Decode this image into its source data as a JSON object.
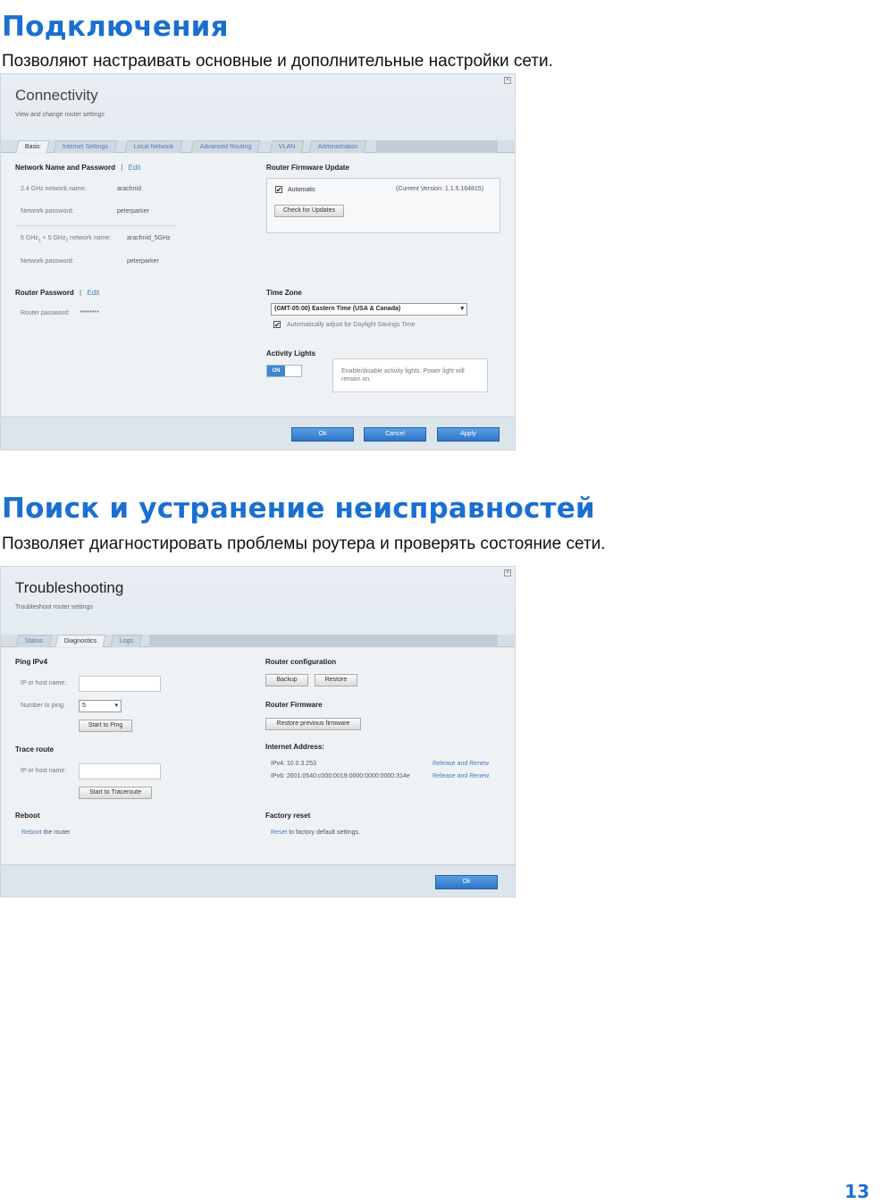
{
  "connectivity": {
    "heading": "Подключения",
    "description": "Позволяют настраивать основные и дополнительные настройки сети.",
    "window_title": "Connectivity",
    "window_subtitle": "View and change router settings",
    "close_label": "×",
    "tabs": [
      {
        "label": "Basic"
      },
      {
        "label": "Internet Settings"
      },
      {
        "label": "Local Network"
      },
      {
        "label": "Advanced Routing"
      },
      {
        "label": "VLAN"
      },
      {
        "label": "Administration"
      }
    ],
    "network": {
      "title": "Network Name and Password",
      "separator": "|",
      "edit": "Edit",
      "name_24_label": "2.4 GHz network name:",
      "name_24_value": "arachnid",
      "password_label": "Network password:",
      "password_24_value": "peterparker",
      "name_5_label_a": "5 GHz",
      "name_5_sub1": "1",
      "name_5_plus": " + 5 GHz",
      "name_5_sub2": "2",
      "name_5_label_b": " network name:",
      "name_5_value": "arachnid_5GHz",
      "password_5_value": "peterparker"
    },
    "router_password": {
      "title": "Router Password",
      "separator": "|",
      "edit": "Edit",
      "label": "Router password:",
      "value": "********"
    },
    "firmware": {
      "title": "Router Firmware Update",
      "check_mark": "✔",
      "automatic_label": "Automatic",
      "version": "(Current Version: 1.1.5.164815)",
      "check_button": "Check for Updates"
    },
    "time_zone": {
      "title": "Time Zone",
      "selected": "(GMT-05:00) Eastern Time (USA & Canada)",
      "arrow": "▾",
      "check_mark": "✔",
      "dst_label": "Automatically adjust for Daylight Savings Time"
    },
    "activity_lights": {
      "title": "Activity Lights",
      "toggle_label": "ON",
      "info": "Enable/disable activity lights. Power light will remain on."
    },
    "buttons": {
      "ok": "Ok",
      "cancel": "Cancel",
      "apply": "Apply"
    }
  },
  "troubleshooting": {
    "heading": "Поиск и устранение неисправностей",
    "description": "Позволяет диагностировать проблемы роутера и проверять состояние сети.",
    "window_title": "Troubleshooting",
    "window_subtitle": "Troubleshoot router settings",
    "close_label": "×",
    "tabs": [
      {
        "label": "Status"
      },
      {
        "label": "Diagnostics"
      },
      {
        "label": "Logs"
      }
    ],
    "ping": {
      "title": "Ping IPv4",
      "host_label": "IP or host name:",
      "host_value": "",
      "number_label": "Number to ping:",
      "number_value": "5",
      "arrow": "▾",
      "start_button": "Start to Ping"
    },
    "trace": {
      "title": "Trace route",
      "host_label": "IP or host name:",
      "host_value": "",
      "start_button": "Start to Traceroute"
    },
    "reboot": {
      "title": "Reboot",
      "link": "Reboot",
      "text": " the router"
    },
    "router_config": {
      "title": "Router configuration",
      "backup": "Backup",
      "restore": "Restore"
    },
    "router_firmware": {
      "title": "Router Firmware",
      "restore_previous": "Restore previous firmware"
    },
    "internet_address": {
      "title": "Internet Address:",
      "ipv4": "IPv4: 10.0.3.253",
      "ipv6": "IPv6: 2601:0540:c000:0019:0000:0000:0000:314e",
      "release_renew": "Release and Renew"
    },
    "factory_reset": {
      "title": "Factory reset",
      "link": "Reset",
      "text": " to factory default settings."
    },
    "buttons": {
      "ok": "Ok"
    }
  },
  "page_number": "13",
  "colors": {
    "accent": "#1a6fd1",
    "link": "#4a7bbd",
    "button_blue": "#2e74c4"
  }
}
